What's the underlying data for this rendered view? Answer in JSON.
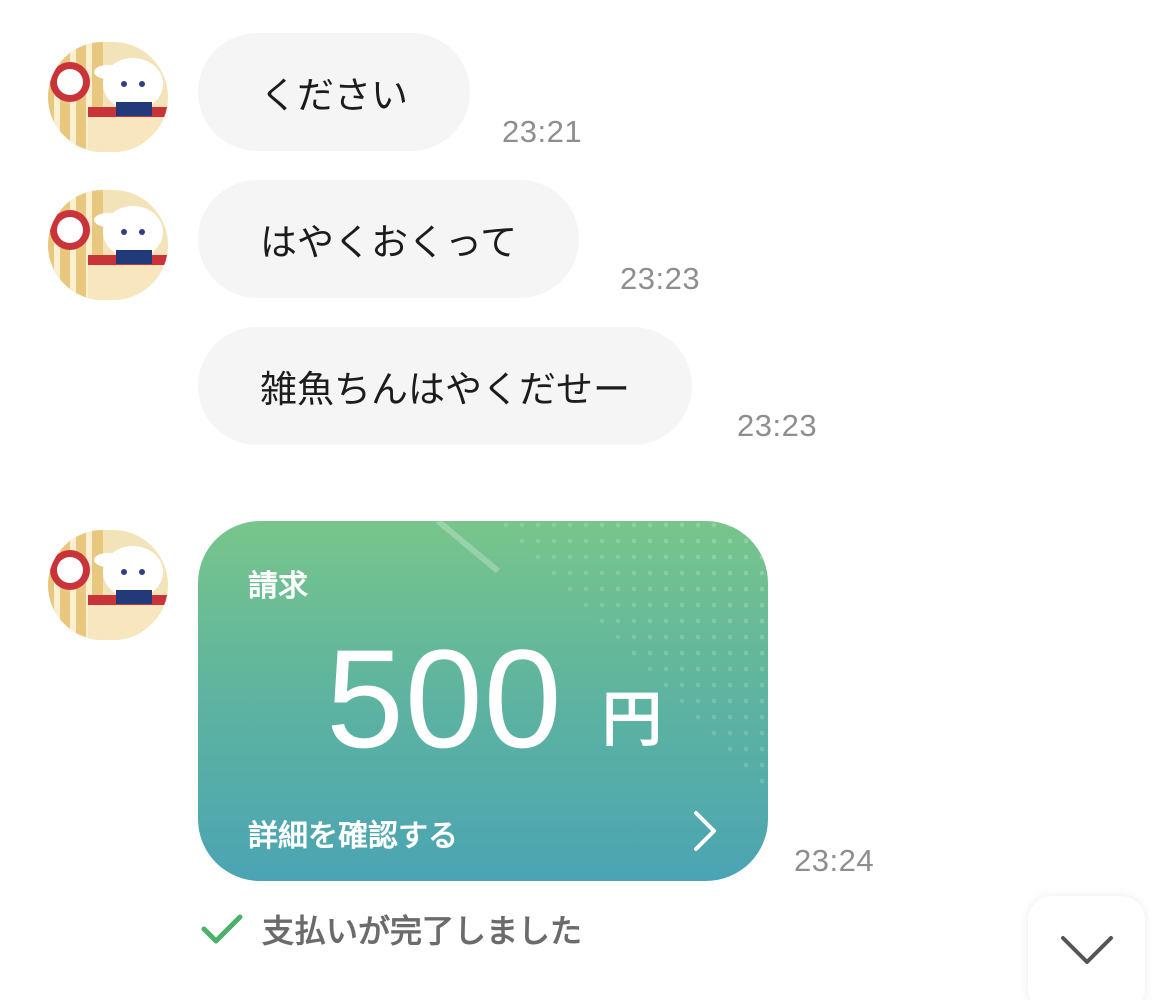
{
  "messages": [
    {
      "text": "ください",
      "time": "23:21",
      "has_avatar": true
    },
    {
      "text": "はやくおくって",
      "time": "23:23",
      "has_avatar": true
    },
    {
      "text": "雑魚ちんはやくだせー",
      "time": "23:23",
      "has_avatar": false
    }
  ],
  "request_card": {
    "title": "請求",
    "amount": "500",
    "unit": "円",
    "detail_link": "詳細を確認する",
    "time": "23:24",
    "gradient_top": "#78c58b",
    "gradient_bottom": "#4ba4b4"
  },
  "payment_status": {
    "text": "支払いが完了しました",
    "icon": "check-icon",
    "icon_color": "#4caf6a"
  },
  "scroll_down_button": {
    "icon": "chevron-down-icon"
  },
  "avatar": {
    "icon": "sender-avatar"
  }
}
